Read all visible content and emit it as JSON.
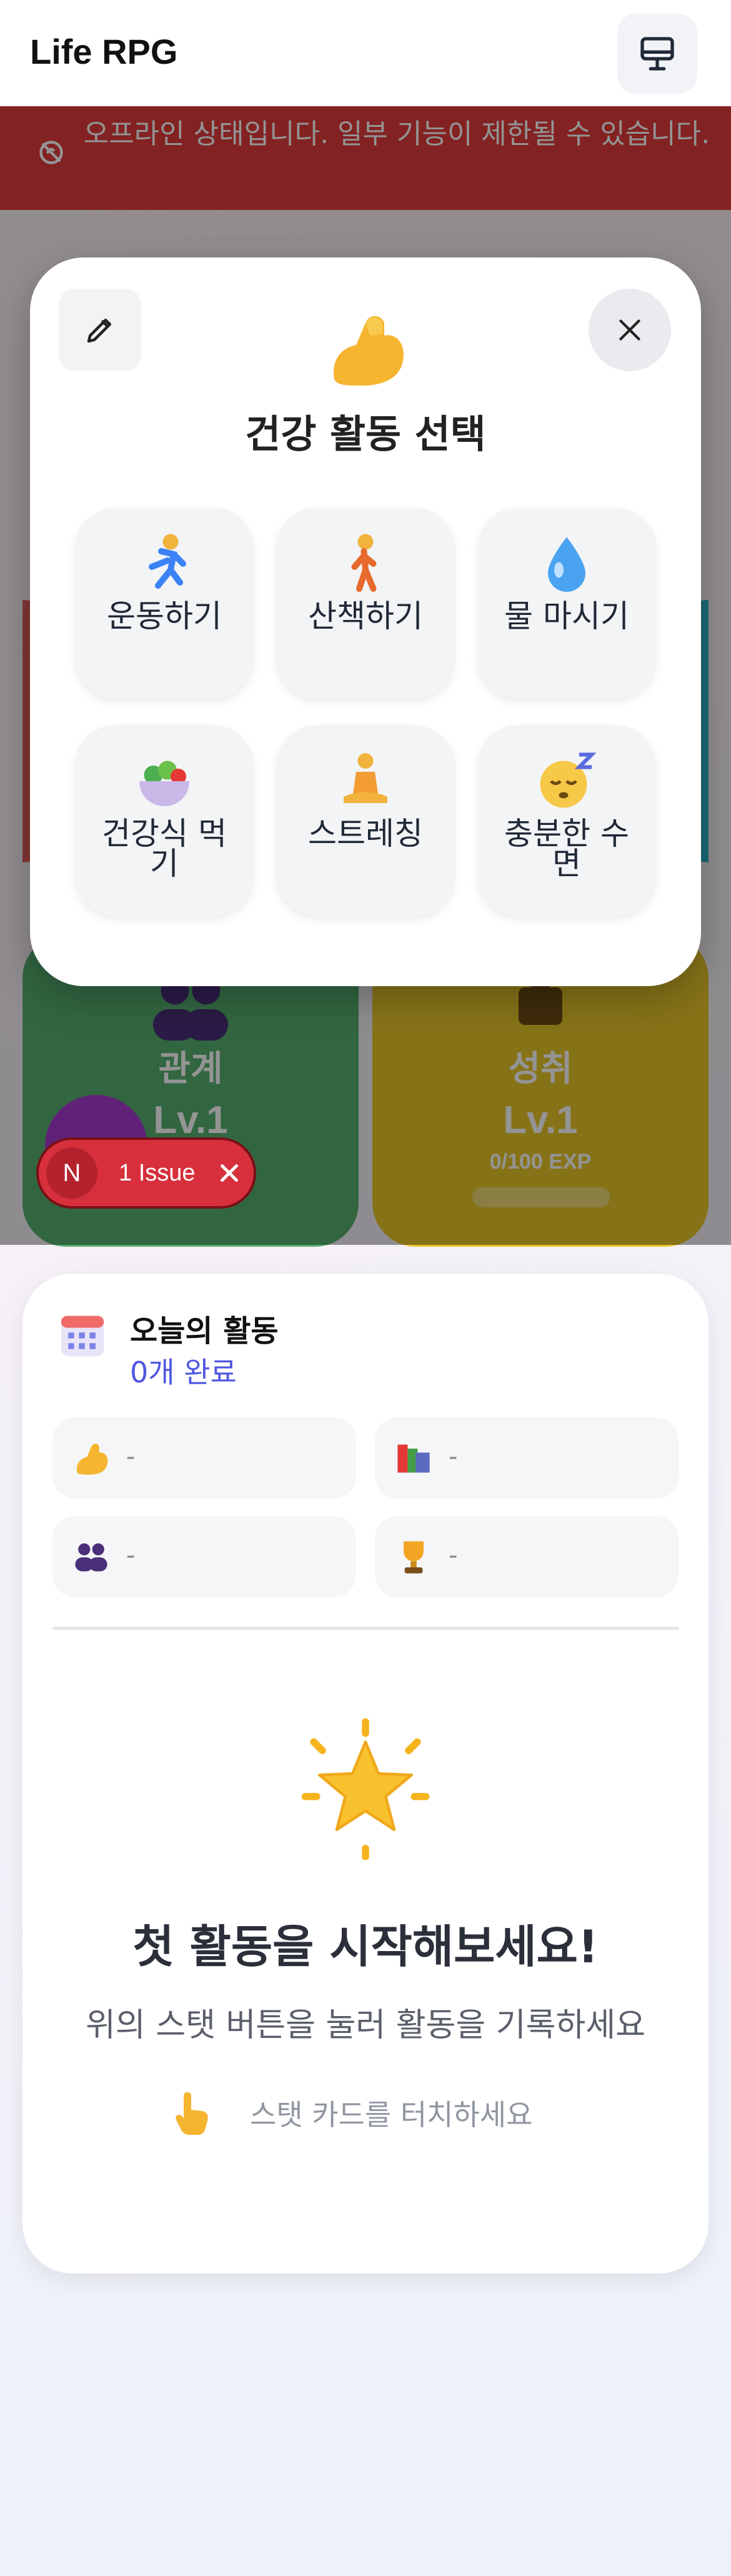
{
  "header": {
    "title": "Life RPG",
    "device_icon": "monitor-icon"
  },
  "banner": {
    "text": "오프라인 상태입니다. 일부 기능이 제한될 수 있습니다.",
    "icon": "offline-icon",
    "color": "#e23b3b"
  },
  "background_cards": [
    {
      "name": "관계",
      "level": "Lv.1",
      "exp": "",
      "color": "#56b071"
    },
    {
      "name": "성취",
      "level": "Lv.1",
      "exp": "0/100 EXP",
      "color": "#e7c72a"
    }
  ],
  "issue_badge": {
    "initial": "N",
    "label": "1 Issue"
  },
  "modal": {
    "title": "건강 활동 선택",
    "header_icon": "flexed-biceps-icon",
    "options": [
      {
        "label": "운동하기",
        "icon": "runner-icon"
      },
      {
        "label": "산책하기",
        "icon": "walker-icon"
      },
      {
        "label": "물 마시기",
        "icon": "water-drop-icon"
      },
      {
        "label": "건강식 먹기",
        "icon": "salad-icon"
      },
      {
        "label": "스트레칭",
        "icon": "meditation-icon"
      },
      {
        "label": "충분한 수면",
        "icon": "sleeping-face-icon"
      }
    ]
  },
  "today": {
    "title": "오늘의 활동",
    "count": "0개 완료",
    "stats": [
      {
        "icon": "biceps-icon",
        "value": "-"
      },
      {
        "icon": "books-icon",
        "value": "-"
      },
      {
        "icon": "people-icon",
        "value": "-"
      },
      {
        "icon": "trophy-icon",
        "value": "-"
      }
    ],
    "empty_title": "첫 활동을 시작해보세요!",
    "empty_subtitle": "위의 스탯 버튼을 눌러 활동을 기록하세요",
    "hint": "스탯 카드를 터치하세요"
  }
}
